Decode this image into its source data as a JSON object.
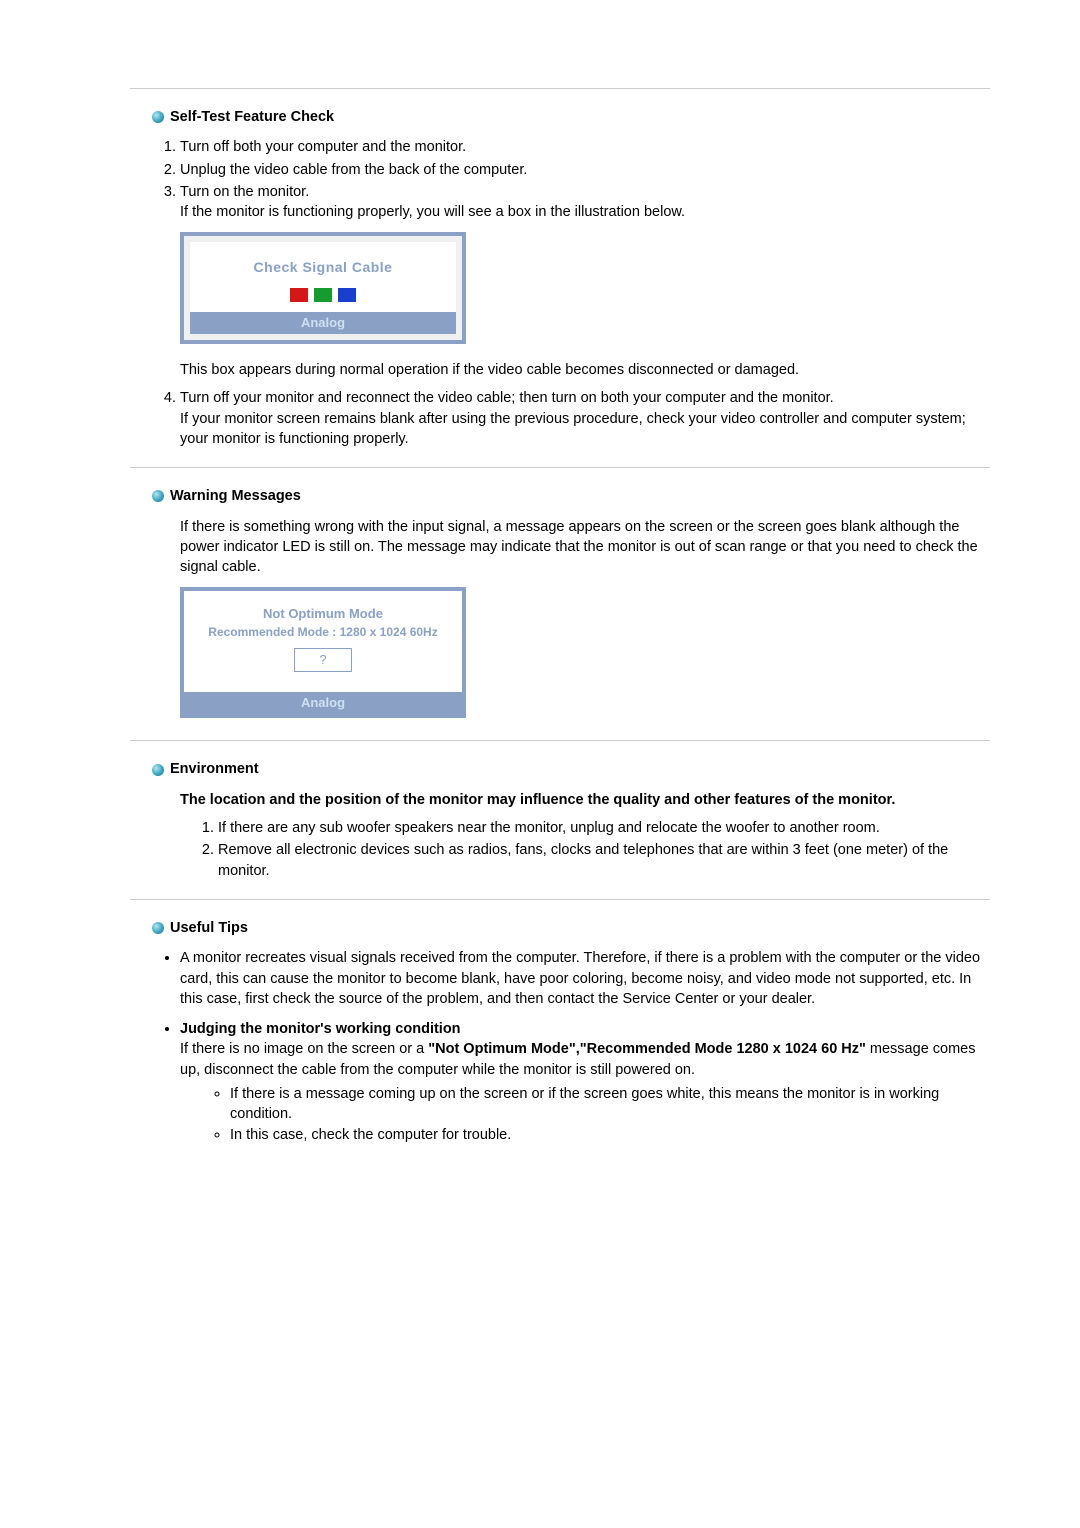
{
  "sections": {
    "selftest": {
      "heading": "Self-Test Feature Check",
      "steps": {
        "0": "Turn off both your computer and the monitor.",
        "1": "Unplug the video cable from the back of the computer.",
        "2": "Turn on the monitor.",
        "2b": "If the monitor is functioning properly, you will see a box in the illustration below.",
        "3a": "This box appears during normal operation if the video cable becomes disconnected or damaged.",
        "4a": "Turn off your monitor and reconnect the video cable; then turn on both your computer and the monitor.",
        "4b": "If your monitor screen remains blank after using the previous procedure, check your video controller and computer system; your monitor is functioning properly."
      },
      "box1": {
        "signal": "Check Signal Cable",
        "analog": "Analog"
      }
    },
    "warning": {
      "heading": "Warning Messages",
      "para": "If there is something wrong with the input signal, a message appears on the screen or the screen goes blank although the power indicator LED is still on. The message may indicate that the monitor is out of scan range or that you need to check the signal cable.",
      "box2": {
        "line1": "Not Optimum Mode",
        "line2": "Recommended Mode : 1280 x 1024  60Hz",
        "q": "?",
        "analog": "Analog"
      }
    },
    "env": {
      "heading": "Environment",
      "intro": "The location and the position of the monitor may influence the quality and other features of the monitor.",
      "items": {
        "0": "If there are any sub woofer speakers near the monitor, unplug and relocate the woofer to another room.",
        "1": "Remove all electronic devices such as radios, fans, clocks and telephones that are within 3 feet (one meter) of the monitor."
      }
    },
    "tips": {
      "heading": "Useful Tips",
      "b1": "A monitor recreates visual signals received from the computer. Therefore, if there is a problem with the computer or the video card, this can cause the monitor to become blank, have poor coloring, become noisy, and video mode not supported, etc. In this case, first check the source of the problem, and then contact the Service Center or your dealer.",
      "b2_head": "Judging the monitor's working condition",
      "b2_pre": "If there is no image on the screen or a ",
      "b2_quote": "\"Not Optimum Mode\",\"Recommended Mode 1280 x 1024 60 Hz\"",
      "b2_post": " message comes up, disconnect the cable from the computer while the monitor is still powered on.",
      "sub": {
        "0": "If there is a message coming up on the screen or if the screen goes white, this means the monitor is in working condition.",
        "1": "In this case, check the computer for trouble."
      }
    }
  }
}
